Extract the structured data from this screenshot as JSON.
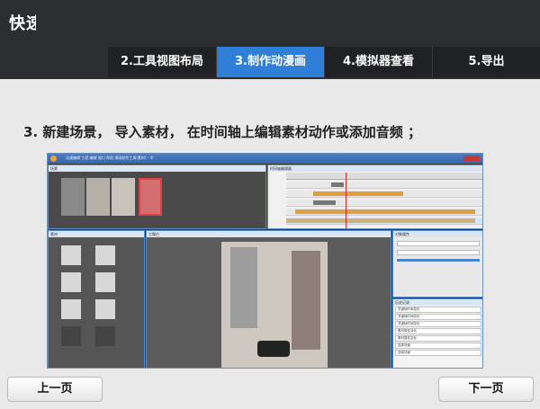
{
  "app": {
    "title": "快速入门"
  },
  "tabs": [
    {
      "label": "2.工具视图布局",
      "active": false
    },
    {
      "label": "3.制作动漫画",
      "active": true
    },
    {
      "label": "4.模拟器查看",
      "active": false
    },
    {
      "label": "5.导出",
      "active": false
    }
  ],
  "step": {
    "instruction": "3. 新建场景， 导入素材， 在时间轴上编辑素材动作或添加音频 ；"
  },
  "embedded_app": {
    "menu": "动漫编辑   工程  编辑  窗口  帮助  漫画制作工具(素材) - 4)",
    "panes": {
      "scene": "场景",
      "timeline": "时间轴编辑器",
      "material": "素材",
      "stage": "主舞台",
      "properties": "对象属性",
      "history": "历史记录"
    },
    "history_items": [
      "关键帧时间变化",
      "关键帧时间变化",
      "关键帧时间变化",
      "素材属性变化",
      "素材属性变化",
      "选择场景",
      "选择场景"
    ]
  },
  "navigation": {
    "prev_label": "上一页",
    "next_label": "下一页"
  },
  "colors": {
    "accent": "#2f7fd9",
    "topbar": "#2b2d31"
  }
}
